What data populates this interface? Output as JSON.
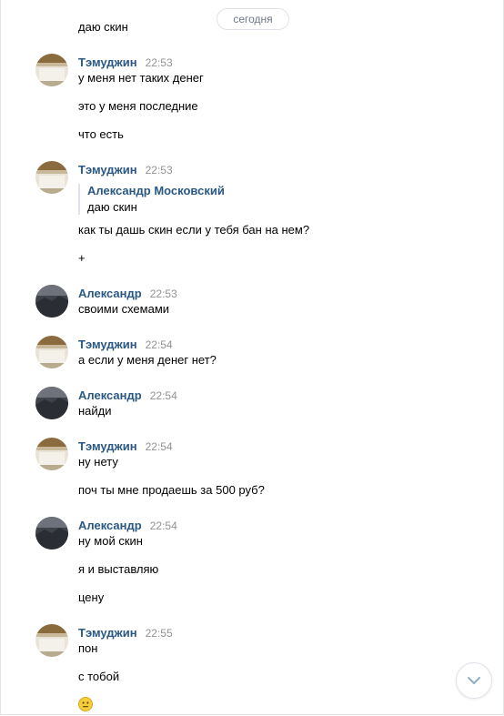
{
  "date_divider": "сегодня",
  "messages": [
    {
      "continuation": "даю скин"
    },
    {
      "author": "Тэмуджин",
      "time": "22:53",
      "lines": [
        "у меня нет таких денег",
        "это у меня последние",
        "что есть"
      ]
    },
    {
      "author": "Тэмуджин",
      "time": "22:53",
      "quote": {
        "author": "Александр Московский",
        "text": "даю скин"
      },
      "lines": [
        "как ты дашь скин если у тебя бан на нем?",
        "+"
      ]
    },
    {
      "author": "Александр",
      "time": "22:53",
      "lines": [
        "своими схемами"
      ]
    },
    {
      "author": "Тэмуджин",
      "time": "22:54",
      "lines": [
        "а если у меня денег нет?"
      ]
    },
    {
      "author": "Александр",
      "time": "22:54",
      "lines": [
        "найди"
      ]
    },
    {
      "author": "Тэмуджин",
      "time": "22:54",
      "lines": [
        "ну нету",
        "поч ты мне продаешь за 500 руб?"
      ]
    },
    {
      "author": "Александр",
      "time": "22:54",
      "lines": [
        "ну мой скин",
        "я и выставляю",
        "цену"
      ]
    },
    {
      "author": "Тэмуджин",
      "time": "22:55",
      "lines": [
        "пон",
        "с тобой"
      ],
      "emoji": "neutral-face"
    }
  ],
  "colors": {
    "author": "#2a5885",
    "time": "#939393",
    "border": "#dfe2e8"
  }
}
